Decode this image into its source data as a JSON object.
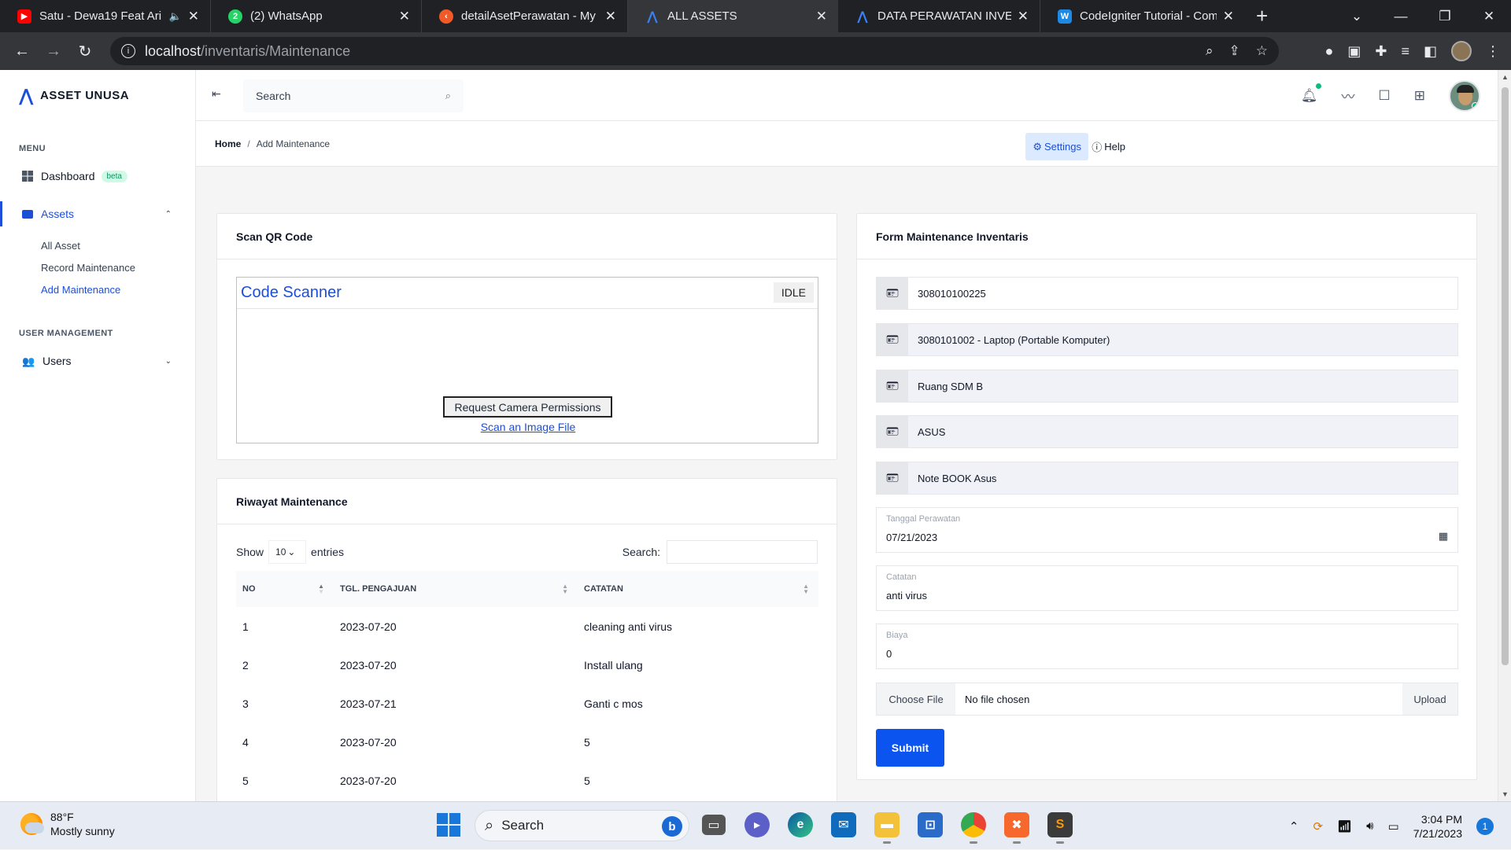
{
  "browser": {
    "tabs": [
      {
        "title": "Satu - Dewa19 Feat Ari",
        "favicon_color": "#ff0000",
        "favicon": "youtube-icon"
      },
      {
        "title": "(2) WhatsApp",
        "favicon_color": "#25d366",
        "favicon": "whatsapp-icon",
        "badge": "2"
      },
      {
        "title": "detailAsetPerawatan - My W",
        "favicon_color": "#f05a28",
        "favicon": "codeigniter-icon"
      },
      {
        "title": "ALL ASSETS",
        "favicon_color": "#1d4ed8",
        "favicon": "asset-logo-icon"
      },
      {
        "title": "DATA PERAWATAN INVENT.",
        "favicon_color": "#1d4ed8",
        "favicon": "asset-logo-icon"
      },
      {
        "title": "CodeIgniter Tutorial - Comp",
        "favicon_color": "#1e88e5",
        "favicon": "word-icon",
        "badge": "W"
      }
    ],
    "url_host": "localhost",
    "url_path": "/inventaris/Maintenance"
  },
  "app": {
    "brand": "ASSET UNUSA",
    "search_placeholder": "Search",
    "sidebar": {
      "menu_title": "MENU",
      "dashboard": "Dashboard",
      "dashboard_badge": "beta",
      "assets": "Assets",
      "sub": [
        "All Asset",
        "Record Maintenance",
        "Add Maintenance"
      ],
      "user_mgmt_title": "USER MANAGEMENT",
      "users": "Users"
    },
    "breadcrumb": {
      "home": "Home",
      "separator": "/",
      "current": "Add Maintenance"
    },
    "settings": "Settings",
    "help": "Help"
  },
  "scan": {
    "title": "Scan QR Code",
    "scanner_title": "Code Scanner",
    "status": "IDLE",
    "request_button": "Request Camera Permissions",
    "scan_image": "Scan an Image File"
  },
  "history": {
    "title": "Riwayat Maintenance",
    "show": "Show",
    "entries_value": "10",
    "entries": "entries",
    "search_label": "Search:",
    "columns": [
      "NO",
      "TGL. PENGAJUAN",
      "CATATAN"
    ],
    "rows": [
      [
        "1",
        "2023-07-20",
        "cleaning anti virus"
      ],
      [
        "2",
        "2023-07-20",
        "Install ulang"
      ],
      [
        "3",
        "2023-07-21",
        "Ganti c mos"
      ],
      [
        "4",
        "2023-07-20",
        "5"
      ],
      [
        "5",
        "2023-07-20",
        "5"
      ]
    ]
  },
  "form": {
    "title": "Form Maintenance Inventaris",
    "fields": [
      "308010100225",
      "3080101002 - Laptop (Portable Komputer)",
      "Ruang SDM B",
      "ASUS",
      "Note BOOK Asus"
    ],
    "tanggal_label": "Tanggal Perawatan",
    "tanggal_value": "07/21/2023",
    "catatan_label": "Catatan",
    "catatan_value": "anti virus",
    "biaya_label": "Biaya",
    "biaya_value": "0",
    "choose_file": "Choose File",
    "no_file": "No file chosen",
    "upload": "Upload",
    "submit": "Submit"
  },
  "taskbar": {
    "temp": "88°F",
    "weather": "Mostly sunny",
    "search": "Search",
    "time": "3:04 PM",
    "date": "7/21/2023",
    "notifications": "1"
  }
}
